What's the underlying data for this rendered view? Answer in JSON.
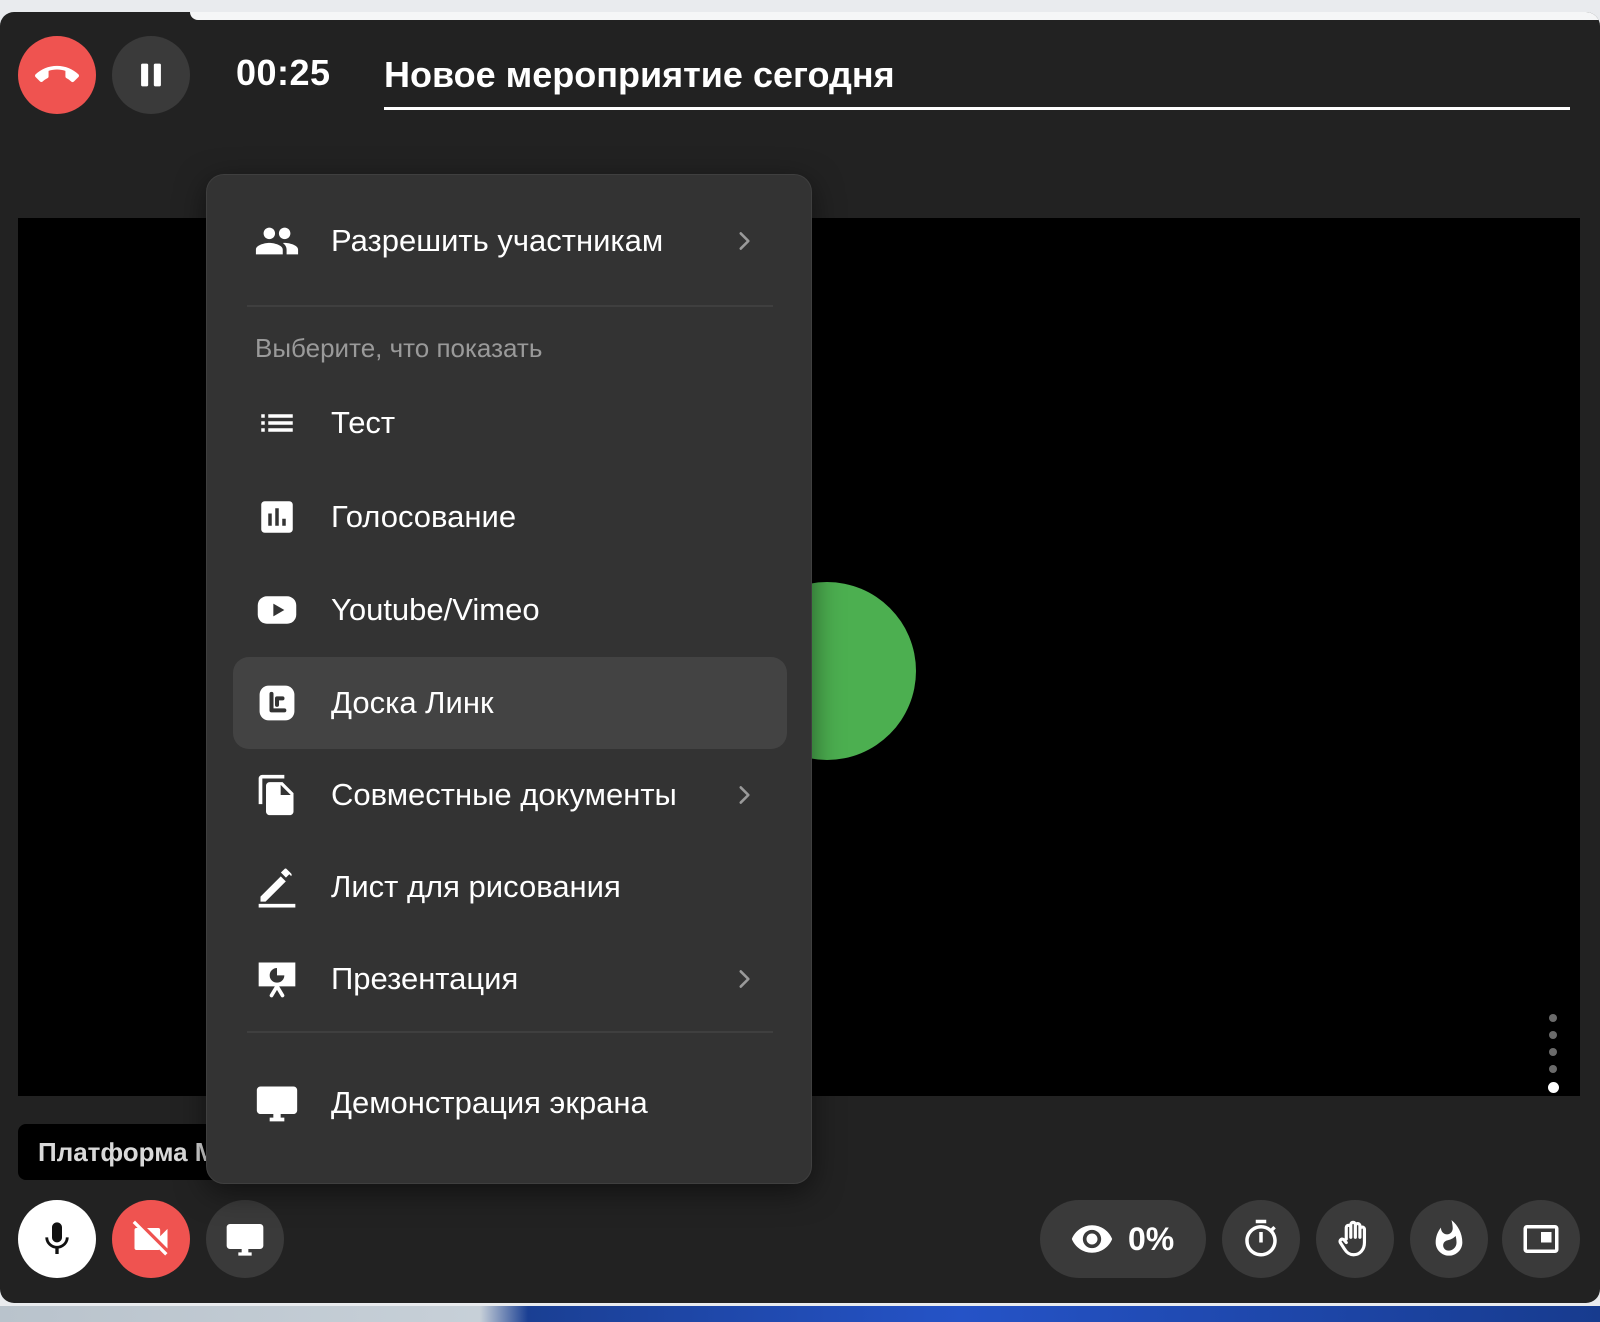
{
  "header": {
    "timer": "00:25",
    "title": "Новое мероприятие сегодня"
  },
  "participant": {
    "name_label": "Платформа М"
  },
  "share_menu": {
    "allow_participants_label": "Разрешить участникам",
    "section_caption": "Выберите, что показать",
    "items": [
      {
        "label": "Тест",
        "icon": "list-icon"
      },
      {
        "label": "Голосование",
        "icon": "poll-chart-icon"
      },
      {
        "label": "Youtube/Vimeo",
        "icon": "youtube-play-icon"
      },
      {
        "label": "Доска Линк",
        "icon": "whiteboard-icon"
      },
      {
        "label": "Совместные документы",
        "icon": "documents-icon"
      },
      {
        "label": "Лист для рисования",
        "icon": "pencil-icon"
      },
      {
        "label": "Презентация",
        "icon": "presentation-icon"
      }
    ],
    "screen_share_label": "Демонстрация экрана",
    "hovered_item": "Доска Линк"
  },
  "toolbar": {
    "views_percent": "0%"
  },
  "colors": {
    "window_bg": "#222222",
    "stage_bg": "#000000",
    "danger": "#ef5350",
    "avatar_green": "#4caf50",
    "menu_bg": "#333333",
    "button_bg": "#3a3a3a"
  }
}
